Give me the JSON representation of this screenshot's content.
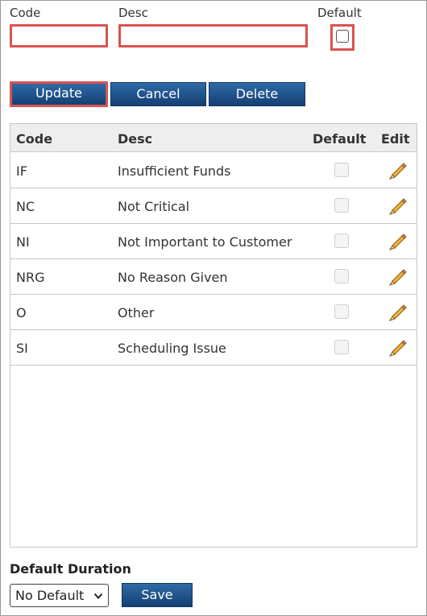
{
  "form": {
    "code_label": "Code",
    "desc_label": "Desc",
    "default_label": "Default",
    "code_value": "",
    "desc_value": ""
  },
  "buttons": {
    "update": "Update",
    "cancel": "Cancel",
    "delete": "Delete",
    "save": "Save"
  },
  "table": {
    "columns": [
      "Code",
      "Desc",
      "Default",
      "Edit"
    ],
    "rows": [
      {
        "code": "IF",
        "desc": "Insufficient Funds",
        "default": false
      },
      {
        "code": "NC",
        "desc": "Not Critical",
        "default": false
      },
      {
        "code": "NI",
        "desc": "Not Important to Customer",
        "default": false
      },
      {
        "code": "NRG",
        "desc": "No Reason Given",
        "default": false
      },
      {
        "code": "O",
        "desc": "Other",
        "default": false
      },
      {
        "code": "SI",
        "desc": "Scheduling Issue",
        "default": false
      }
    ]
  },
  "default_duration": {
    "label": "Default Duration",
    "selected": "No Default"
  },
  "colors": {
    "highlight": "#d9534f",
    "button": "#1f4f86"
  }
}
